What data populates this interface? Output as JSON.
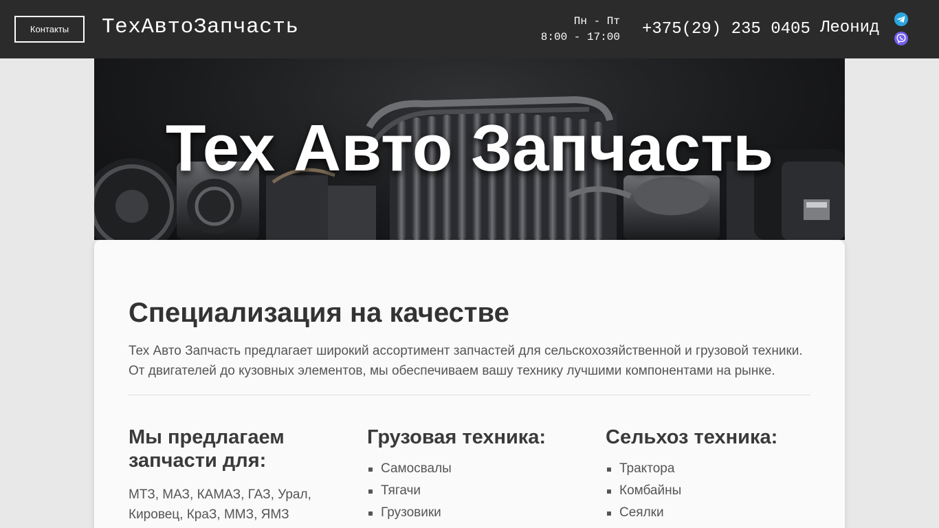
{
  "header": {
    "contacts_button": "Контакты",
    "brand": "ТехАвтоЗапчасть",
    "hours_days": "Пн - Пт",
    "hours_time": "8:00 - 17:00",
    "phone": "+375(29) 235 0405",
    "person": "Леонид",
    "icons": [
      "telegram-icon",
      "viber-icon"
    ]
  },
  "hero": {
    "title": "Тех Авто Запчасть"
  },
  "main": {
    "title": "Специализация на качестве",
    "intro_line1": "Тех Авто Запчасть предлагает широкий ассортимент запчастей для сельскохозяйственной и грузовой техники.",
    "intro_line2": "От двигателей до кузовных элементов, мы обеспечиваем вашу технику лучшими компонентами на рынке.",
    "columns": [
      {
        "title": "Мы предлагаем запчасти для:",
        "text": "МТЗ, МАЗ, КАМАЗ, ГАЗ, Урал, Кировец, КраЗ, ММЗ, ЯМЗ"
      },
      {
        "title": "Грузовая техника:",
        "items": [
          "Самосвалы",
          "Тягачи",
          "Грузовики"
        ]
      },
      {
        "title": "Сельхоз техника:",
        "items": [
          "Трактора",
          "Комбайны",
          "Сеялки"
        ]
      }
    ]
  },
  "colors": {
    "header_bg": "#2b2b2b",
    "page_bg": "#e8e8e8",
    "card_bg": "#fafafa",
    "telegram": "#2ca5e0",
    "viber": "#7360f2"
  }
}
